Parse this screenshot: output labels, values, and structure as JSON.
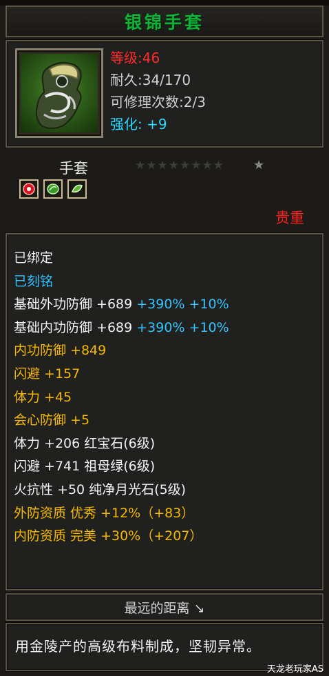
{
  "item": {
    "name": "银锦手套",
    "level": "等级:46",
    "durability": "耐久:34/170",
    "repairs": "可修理次数:2/3",
    "enhance": "强化: +9",
    "type": "手套",
    "stars_dim": "★★★★★★★★",
    "star_lit": "★",
    "quality": "贵重",
    "signature": "最远的距离 ↘",
    "description": "用金陵产的高级布料制成，坚韧异常。"
  },
  "attributes": [
    {
      "text": "已绑定",
      "color": "white"
    },
    {
      "text": "已刻铭",
      "color": "blue"
    },
    {
      "text_a": "基础外功防御 +689 ",
      "text_b": "+390% +10%"
    },
    {
      "text_a": "基础内功防御 +689 ",
      "text_b": "+390% +10%"
    },
    {
      "text": "内功防御 +849",
      "color": "gold"
    },
    {
      "text": "闪避 +157",
      "color": "gold"
    },
    {
      "text": "体力 +45",
      "color": "gold"
    },
    {
      "text": "会心防御 +5",
      "color": "gold"
    },
    {
      "text": "体力 +206 红宝石(6级)",
      "color": "white"
    },
    {
      "text": "闪避 +741 祖母绿(6级)",
      "color": "white"
    },
    {
      "text": "火抗性 +50 纯净月光石(5级)",
      "color": "white"
    },
    {
      "text": "外防资质  优秀 +12%（+83）",
      "color": "gold"
    },
    {
      "text": "内防资质  完美 +30%（+207）",
      "color": "gold"
    }
  ],
  "gems": [
    {
      "icon": "ruby-gem-icon",
      "color": "#d8141e"
    },
    {
      "icon": "emerald-gem-icon",
      "color": "#3a9a2a"
    },
    {
      "icon": "moonstone-gem-icon",
      "color": "#5fb83a"
    }
  ],
  "watermark": "天龙老玩家AS",
  "colors": {
    "title_green": "#15b03a",
    "stat_red": "#ff2a2a",
    "stat_cyan": "#2ad9ff",
    "attr_gold": "#f5b800",
    "attr_blue": "#34c3ff"
  }
}
